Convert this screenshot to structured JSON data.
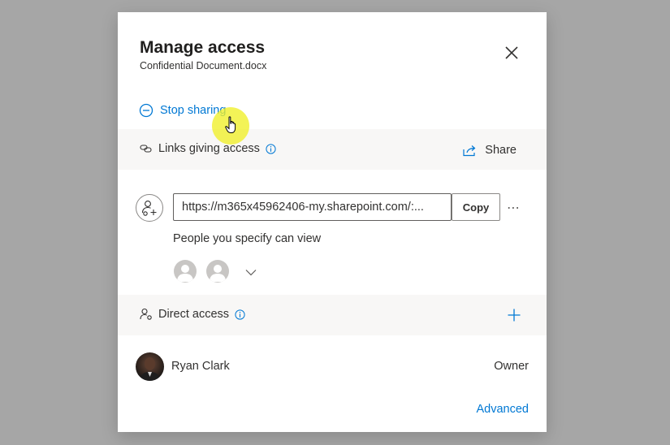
{
  "dialog": {
    "title": "Manage access",
    "subtitle": "Confidential Document.docx"
  },
  "actions": {
    "stop_sharing": "Stop sharing"
  },
  "links_section": {
    "label": "Links giving access",
    "share_label": "Share",
    "link_url": "https://m365x45962406-my.sharepoint.com/:...",
    "copy_label": "Copy",
    "more_label": "⋯",
    "description": "People you specify can view"
  },
  "direct_section": {
    "label": "Direct access"
  },
  "people": [
    {
      "name": "Ryan Clark",
      "role": "Owner"
    }
  ],
  "footer": {
    "advanced": "Advanced"
  },
  "colors": {
    "accent": "#0078d4",
    "overlay": "#a6a6a6",
    "band": "#f8f7f6"
  },
  "icons": [
    "close-icon",
    "minus-circle-icon",
    "link-icon",
    "info-icon",
    "share-icon",
    "people-link-icon",
    "user-icon",
    "chevron-down-icon",
    "person-settings-icon",
    "plus-icon",
    "pointer-hand-icon"
  ]
}
